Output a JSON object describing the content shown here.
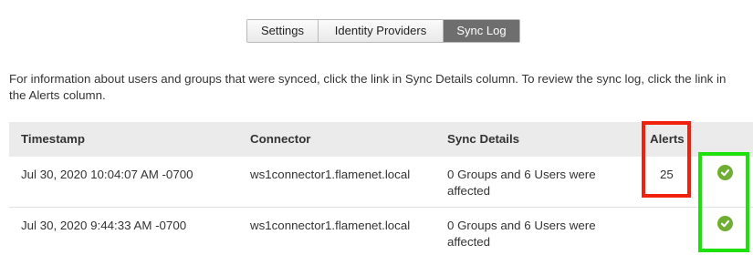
{
  "tabs": [
    {
      "label": "Settings",
      "active": false
    },
    {
      "label": "Identity Providers",
      "active": false
    },
    {
      "label": "Sync Log",
      "active": true
    }
  ],
  "intro": "For information about users and groups that were synced, click the link in Sync Details column. To review the sync log, click the link in the Alerts column.",
  "table": {
    "headers": {
      "timestamp": "Timestamp",
      "connector": "Connector",
      "sync_details": "Sync Details",
      "alerts": "Alerts"
    },
    "rows": [
      {
        "timestamp": "Jul 30, 2020 10:04:07 AM -0700",
        "connector": "ws1connector1.flamenet.local",
        "sync_details": "0 Groups and 6 Users were affected",
        "alerts": "25",
        "status_icon": "check-circle-icon"
      },
      {
        "timestamp": "Jul 30, 2020 9:44:33 AM -0700",
        "connector": "ws1connector1.flamenet.local",
        "sync_details": "0 Groups and 6 Users were affected",
        "alerts": "",
        "status_icon": "check-circle-icon"
      }
    ]
  },
  "colors": {
    "link": "#3d8ed0",
    "active_tab": "#6e6e6e",
    "success": "#6fae32",
    "annotation_red": "#f2210e",
    "annotation_green": "#1ee00a"
  }
}
